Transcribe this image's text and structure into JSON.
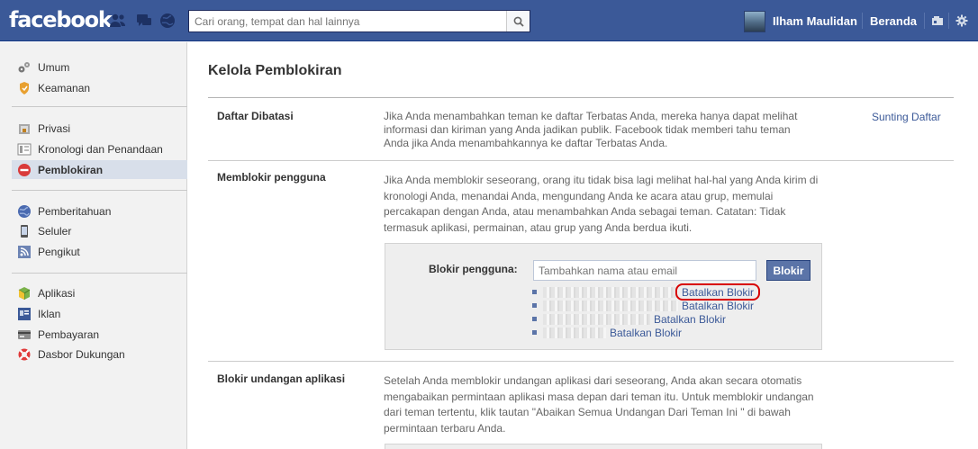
{
  "brand": {
    "logo": "facebook",
    "color": "#3b5998"
  },
  "topbar": {
    "search_placeholder": "Cari orang, tempat dan hal lainnya",
    "user_name": "Ilham Maulidan",
    "home_label": "Beranda",
    "icons": [
      "friend-requests-icon",
      "messages-icon",
      "notifications-icon",
      "search-icon",
      "privacy-shortcut-icon",
      "settings-gear-icon"
    ]
  },
  "sidebar": {
    "groups": [
      [
        {
          "label": "Umum",
          "icon": "gears-icon"
        },
        {
          "label": "Keamanan",
          "icon": "badge-icon"
        }
      ],
      [
        {
          "label": "Privasi",
          "icon": "lock-icon"
        },
        {
          "label": "Kronologi dan Penandaan",
          "icon": "timeline-icon"
        },
        {
          "label": "Pemblokiran",
          "icon": "block-icon",
          "active": true
        }
      ],
      [
        {
          "label": "Pemberitahuan",
          "icon": "globe-icon"
        },
        {
          "label": "Seluler",
          "icon": "mobile-icon"
        },
        {
          "label": "Pengikut",
          "icon": "rss-icon"
        }
      ],
      [
        {
          "label": "Aplikasi",
          "icon": "cube-icon"
        },
        {
          "label": "Iklan",
          "icon": "ads-icon"
        },
        {
          "label": "Pembayaran",
          "icon": "payments-icon"
        },
        {
          "label": "Dasbor Dukungan",
          "icon": "lifebuoy-icon"
        }
      ]
    ]
  },
  "main": {
    "title": "Kelola Pemblokiran",
    "sections": {
      "restricted": {
        "title": "Daftar Dibatasi",
        "desc": [
          "Jika Anda menambahkan teman ke daftar Terbatas Anda, mereka hanya dapat melihat",
          "informasi dan kiriman yang Anda jadikan publik. Facebook tidak memberi tahu teman",
          "Anda jika Anda menambahkannya ke daftar Terbatas Anda."
        ],
        "link": "Sunting Daftar"
      },
      "block_users": {
        "title": "Memblokir pengguna",
        "desc": [
          "Jika Anda memblokir seseorang, orang itu tidak bisa lagi melihat hal-hal yang Anda kirim di",
          "kronologi Anda, menandai Anda, mengundang Anda ke acara atau grup, memulai",
          "percakapan dengan Anda, atau menambahkan Anda sebagai teman. Catatan: Tidak",
          "termasuk aplikasi, permainan, atau grup yang Anda berdua ikuti."
        ],
        "form_label": "Blokir pengguna:",
        "input_placeholder": "Tambahkan nama atau email",
        "button": "Blokir",
        "blocked": [
          {
            "unblock": "Batalkan Blokir",
            "highlighted": true
          },
          {
            "unblock": "Batalkan Blokir"
          },
          {
            "unblock": "Batalkan Blokir"
          },
          {
            "unblock": "Batalkan Blokir"
          }
        ]
      },
      "app_invites": {
        "title": "Blokir undangan aplikasi",
        "desc": [
          "Setelah Anda memblokir undangan aplikasi dari seseorang, Anda akan secara otomatis",
          "mengabaikan permintaan aplikasi masa depan dari teman itu. Untuk memblokir undangan",
          "dari teman tertentu, klik tautan \"Abaikan Semua Undangan Dari Teman Ini \" di bawah",
          "permintaan terbaru Anda."
        ]
      }
    }
  }
}
